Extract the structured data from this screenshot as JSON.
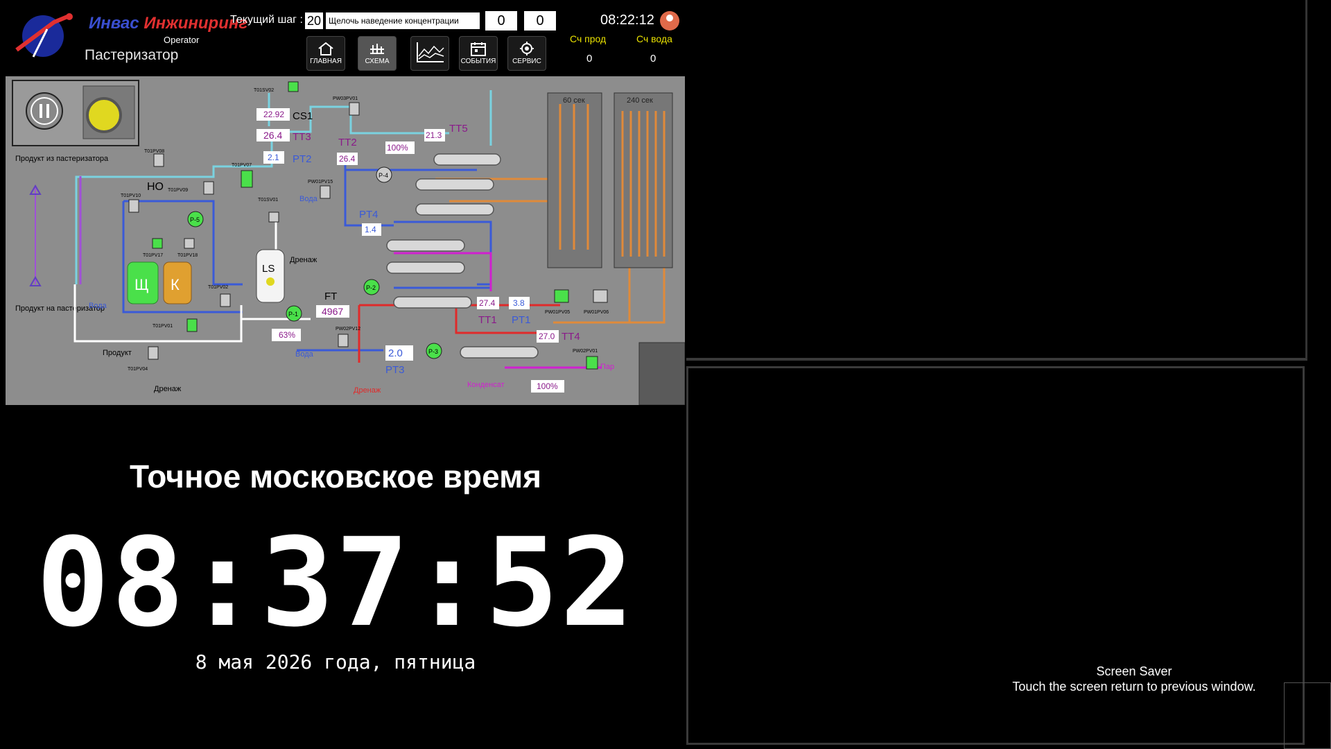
{
  "header": {
    "brand_part1": "Инвас",
    "brand_part2": "Инжиниринг",
    "role": "Operator",
    "app_title": "Пастеризатор",
    "step_label": "Текущий шаг :",
    "step_number": "20",
    "step_description": "Щелочь наведение концентрации",
    "counter_box_1": "0",
    "counter_box_2": "0",
    "time": "08:22:12",
    "nav": [
      {
        "label": "ГЛАВНАЯ",
        "icon": "home-icon"
      },
      {
        "label": "СХЕМА",
        "icon": "scheme-icon"
      },
      {
        "label": "",
        "icon": "chart-icon"
      },
      {
        "label": "СОБЫТИЯ",
        "icon": "calendar-icon"
      },
      {
        "label": "СЕРВИС",
        "icon": "gear-icon"
      }
    ],
    "counter_prod_label": "Сч прод",
    "counter_prod_value": "0",
    "counter_water_label": "Сч вода",
    "counter_water_value": "0"
  },
  "scheme": {
    "product_from": "Продукт из пастеризатора",
    "product_to": "Продукт на пастеризатор",
    "tank_alkali": "Щ",
    "tank_acid": "К",
    "tank_ls": "LS",
    "no_label": "НО",
    "cs1_value": "22.92",
    "cs1_label": "CS1",
    "tt3_value": "26.4",
    "tt3_label": "TT3",
    "pt2_value": "2.1",
    "pt2_label": "PT2",
    "tt2_label": "TT2",
    "tt2_value": "26.4",
    "valve_pct_1": "100%",
    "tt5_value": "21.3",
    "tt5_label": "TT5",
    "pt4_label": "PT4",
    "pt4_value": "1.4",
    "ft_label": "FT",
    "ft_value": "4967",
    "pump_pct": "63%",
    "tt1_value": "27.4",
    "tt1_label": "TT1",
    "pt1_value": "3.8",
    "pt1_label": "PT1",
    "tt4_value": "27.0",
    "tt4_label": "TT4",
    "pt3_value": "2.0",
    "pt3_label": "PT3",
    "valve_pct_2": "100%",
    "hold_60": "60 сек",
    "hold_240": "240 сек",
    "voda_1": "Вода",
    "voda_2": "Вода",
    "voda_3": "Вода",
    "drenazh_1": "Дренаж",
    "drenazh_2": "Дренаж",
    "drenazh_3": "Дренаж",
    "product": "Продукт",
    "kondensat": "Конденсат",
    "par": "Пар",
    "pumps": [
      "P-1",
      "P-2",
      "P-3",
      "P-4",
      "P-5"
    ],
    "tags": {
      "t01sv02": "T01SV02",
      "pw03pv01": "PW03PV01",
      "t01pv08": "T01PV08",
      "t01pv07": "T01PV07",
      "t01pv09": "T01PV09",
      "t01pv10": "T01PV10",
      "t01pv17": "T01PV17",
      "t01pv18": "T01PV18",
      "t01sv01": "T01SV01",
      "pw01pv15": "PW01PV15",
      "t01pv02": "T01PV02",
      "t01pv01": "T01PV01",
      "t01pv04": "T01PV04",
      "pw02pv12": "PW02PV12",
      "pw01pv05": "PW01PV05",
      "pw01pv06": "PW01PV06",
      "pw02pv01": "PW02PV01"
    }
  },
  "clock": {
    "title": "Точное московское время",
    "time": "08:37:52",
    "date": "8 мая 2026 года, пятница"
  },
  "screensaver": {
    "line1": "Screen Saver",
    "line2": "Touch the screen return to previous window."
  },
  "colors": {
    "scheme_bg": "#8d8d8d",
    "pipe_blue": "#3a5ad8",
    "pipe_cyan": "#7ad2e0",
    "pipe_orange": "#e08a3a",
    "pipe_red": "#e02a2a",
    "pipe_magenta": "#d020d0",
    "pump_green": "#4ae04a",
    "value_text": "#8a1a8a"
  }
}
